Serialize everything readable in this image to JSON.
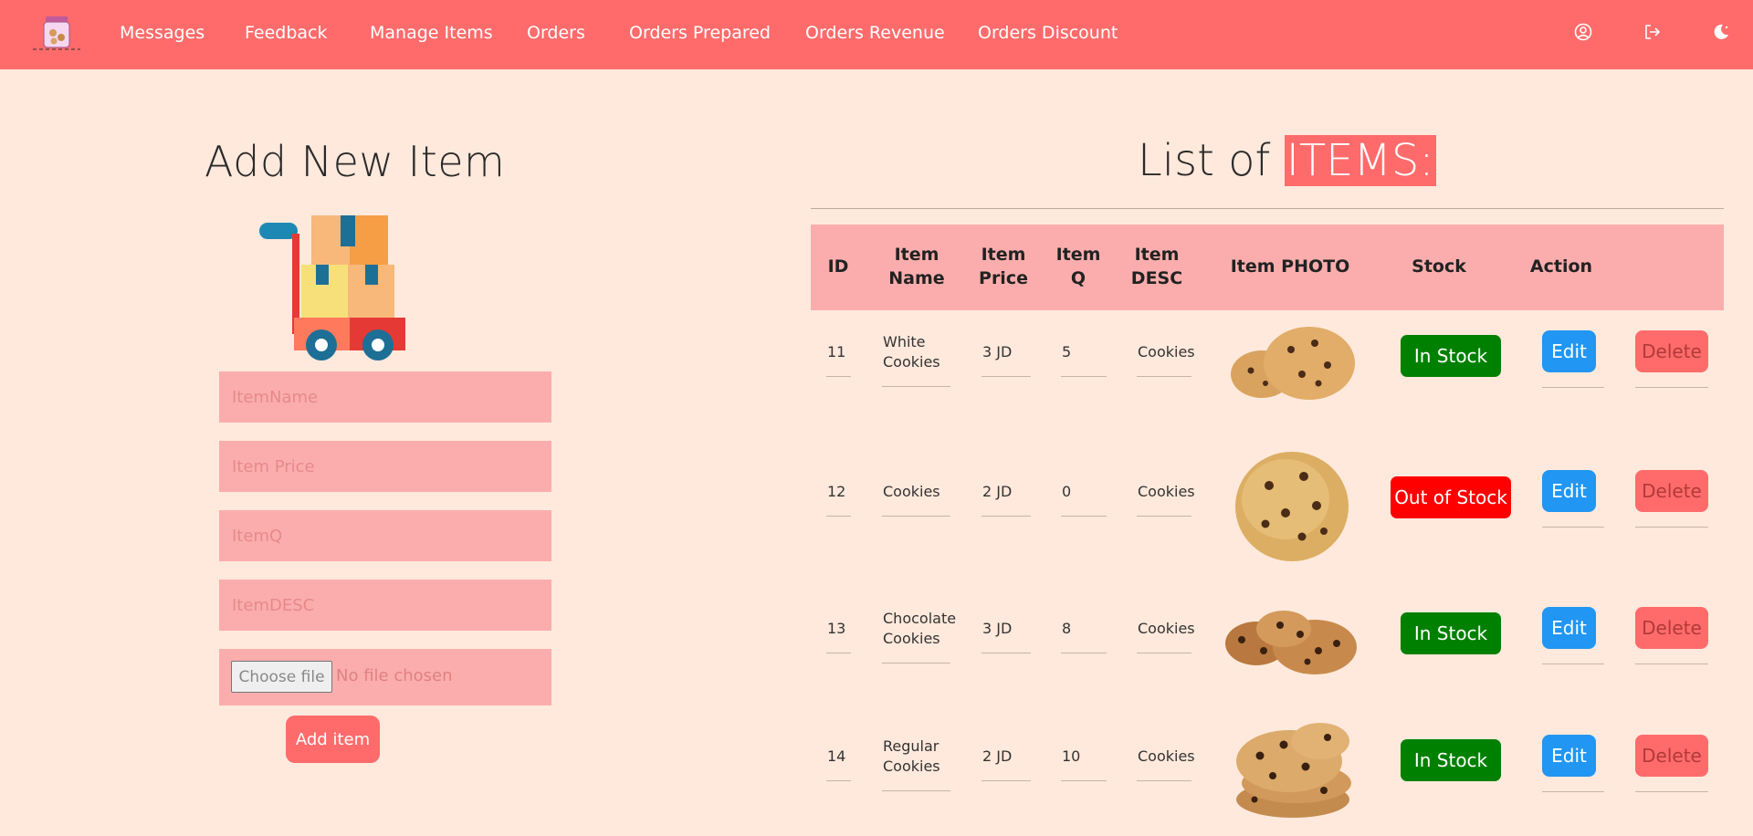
{
  "nav": {
    "links": [
      "Messages",
      "Feedback",
      "Manage Items",
      "Orders",
      "Orders Prepared",
      "Orders Revenue",
      "Orders Discount"
    ],
    "icons": [
      "profile-icon",
      "logout-icon",
      "theme-toggle-icon"
    ]
  },
  "form": {
    "title": "Add New Item",
    "item_name_placeholder": "ItemName",
    "item_price_placeholder": "Item Price",
    "item_q_placeholder": "ItemQ",
    "item_desc_placeholder": "ItemDESC",
    "file_button": "Choose file",
    "file_status": "No file chosen",
    "submit_label": "Add item"
  },
  "list": {
    "title_plain": "List of ",
    "title_highlight": "ITEMS:",
    "columns": {
      "id": "ID",
      "name": "Item Name",
      "price": "Item Price",
      "q": "Item Q",
      "desc": "Item DESC",
      "photo": "Item PHOTO",
      "stock": "Stock",
      "action": "Action"
    },
    "edit_label": "Edit",
    "delete_label": "Delete",
    "rows": [
      {
        "id": "11",
        "name_1": "White",
        "name_2": "Cookies",
        "price": "3 JD",
        "q": "5",
        "desc": "Cookies",
        "stock": "In Stock",
        "stock_color": "#008000"
      },
      {
        "id": "12",
        "name_1": "Cookies",
        "name_2": "",
        "price": "2 JD",
        "q": "0",
        "desc": "Cookies",
        "stock": "Out of Stock",
        "stock_color": "#ff0000"
      },
      {
        "id": "13",
        "name_1": "Chocolate",
        "name_2": "Cookies",
        "price": "3 JD",
        "q": "8",
        "desc": "Cookies",
        "stock": "In Stock",
        "stock_color": "#008000"
      },
      {
        "id": "14",
        "name_1": "Regular",
        "name_2": "Cookies",
        "price": "2 JD",
        "q": "10",
        "desc": "Cookies",
        "stock": "In Stock",
        "stock_color": "#008000"
      }
    ]
  },
  "colors": {
    "navbar": "#ff6b6b",
    "background": "#ffe9dc",
    "field": "#fbadad",
    "edit": "#2196f3",
    "delete": "#ff6b6b"
  }
}
